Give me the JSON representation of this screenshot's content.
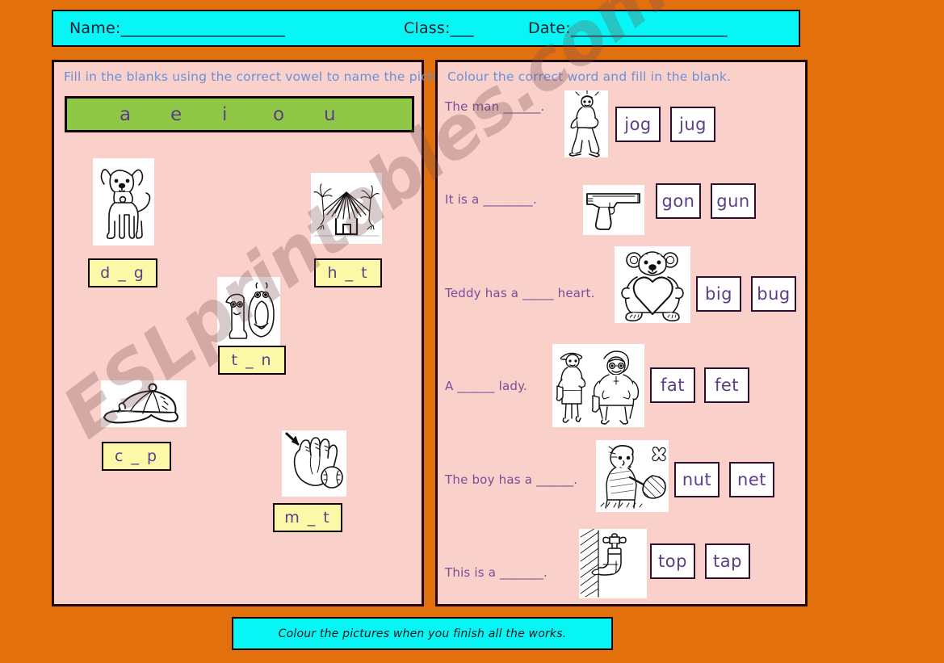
{
  "page": {
    "background_color": "#E2700D",
    "panel_color": "#FAD0CB",
    "accent_cyan": "#07F5F5",
    "accent_green": "#8FC846",
    "accent_yellow": "#FBF8A8",
    "purple_text": "#5B3F86",
    "blue_text": "#6C90D8"
  },
  "header": {
    "name_label": "Name:_____________________",
    "class_label": "Class:___",
    "date_label": "Date:____________________"
  },
  "left_panel": {
    "instruction": "Fill in the blanks using the correct vowel to name the picture.",
    "vowels": [
      "a",
      "e",
      "i",
      "o",
      "u"
    ],
    "items": [
      {
        "picture": "dog-picture",
        "answer_box": "d _ g"
      },
      {
        "picture": "hut-picture",
        "answer_box": "h _ t"
      },
      {
        "picture": "ten-picture",
        "answer_box": "t _ n"
      },
      {
        "picture": "cap-picture",
        "answer_box": "c _ p"
      },
      {
        "picture": "mitt-picture",
        "answer_box": "m _ t"
      }
    ]
  },
  "right_panel": {
    "instruction": "Colour the correct word and fill in the blank.",
    "rows": [
      {
        "sentence": "The man ______.",
        "picture": "jogger-picture",
        "choices": [
          "jog",
          "jug"
        ]
      },
      {
        "sentence": "It is a ________.",
        "picture": "gun-picture",
        "choices": [
          "gon",
          "gun"
        ]
      },
      {
        "sentence": "Teddy has a _____ heart.",
        "picture": "teddy-picture",
        "choices": [
          "big",
          "bug"
        ]
      },
      {
        "sentence": "A ______ lady.",
        "picture": "ladies-picture",
        "choices": [
          "fat",
          "fet"
        ]
      },
      {
        "sentence": "The boy has a ______.",
        "picture": "net-picture",
        "choices": [
          "nut",
          "net"
        ]
      },
      {
        "sentence": "This is a _______.",
        "picture": "tap-picture",
        "choices": [
          "top",
          "tap"
        ]
      }
    ]
  },
  "footer": {
    "note": "Colour the pictures when you finish all the works."
  },
  "watermark": {
    "text": "ESLprintables.com"
  }
}
